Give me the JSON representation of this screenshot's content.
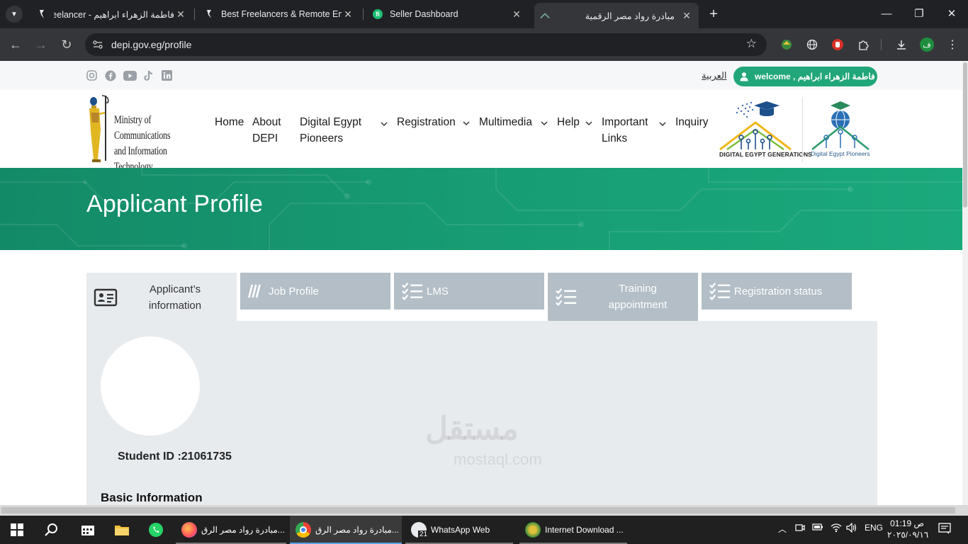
{
  "browser": {
    "tabs": [
      {
        "title": "فاطمة الزهراء ابراهيم - Freelancer",
        "icon": "freelancer-icon"
      },
      {
        "title": "Best Freelancers & Remote Emp",
        "icon": "freelancer-icon"
      },
      {
        "title": "Seller Dashboard",
        "icon": "fiverr-icon"
      },
      {
        "title": "مبادرة رواد مصر الرقمية",
        "icon": "depi-icon"
      }
    ],
    "url": "depi.gov.eg/profile",
    "profile_initial": "ف"
  },
  "site": {
    "language_link": "العربية",
    "welcome": "welcome , فاطمة الزهراء ابراهيم",
    "social": [
      "instagram-icon",
      "facebook-icon",
      "youtube-icon",
      "tiktok-icon",
      "linkedin-icon"
    ],
    "mcit_logo_text": [
      "Ministry of Communications",
      "and Information Technology"
    ],
    "nav": [
      {
        "label": "Home",
        "dropdown": false
      },
      {
        "label": "About DEPI",
        "dropdown": false
      },
      {
        "label": "Digital Egypt Pioneers",
        "dropdown": true
      },
      {
        "label": "Registration",
        "dropdown": true
      },
      {
        "label": "Multimedia",
        "dropdown": true
      },
      {
        "label": "Help",
        "dropdown": true
      },
      {
        "label": "Important Links",
        "dropdown": true
      },
      {
        "label": "Inquiry",
        "dropdown": false
      }
    ],
    "partner_logos": [
      "DIGITAL EGYPT GENERATIONS",
      "Digital Egypt Pioneers"
    ],
    "banner_title": "Applicant Profile",
    "profile_tabs": [
      {
        "label": "Applicant’s information",
        "active": true
      },
      {
        "label": "Job Profile",
        "active": false
      },
      {
        "label": "LMS",
        "active": false
      },
      {
        "label": "Training appointment",
        "active": false
      },
      {
        "label": "Registration status",
        "active": false
      }
    ],
    "student_id": "Student ID :21061735",
    "section_heading": "Basic Information",
    "watermark": "مستقل",
    "watermark_latin": "mostaql.com"
  },
  "taskbar": {
    "apps": [
      {
        "label": "مبادرة رواد مصر الرق...",
        "app": "firefox"
      },
      {
        "label": "مبادرة رواد مصر الرق...",
        "app": "chrome"
      },
      {
        "label": "WhatsApp Web",
        "app": "whatsapp",
        "badge": "21"
      },
      {
        "label": "Internet Download ...",
        "app": "idm"
      }
    ],
    "language": "ENG",
    "time": "01:19 ص",
    "date": "٢٠٢٥/٠٩/١٦"
  }
}
